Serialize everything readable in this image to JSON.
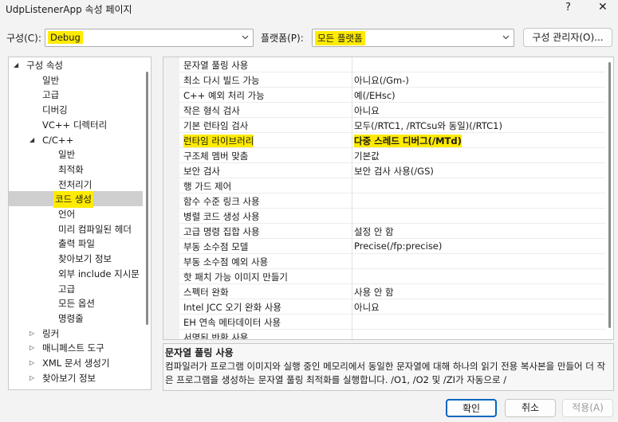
{
  "window": {
    "title": "UdpListenerApp 속성 페이지",
    "help": "?",
    "close": "✕"
  },
  "config": {
    "label": "구성(C):",
    "value": "Debug"
  },
  "platform": {
    "label": "플랫폼(P):",
    "value": "모든 플랫폼"
  },
  "config_manager_label": "구성 관리자(O)...",
  "tree": [
    {
      "label": "구성 속성",
      "level": 0,
      "arrow": "expanded",
      "selected": false
    },
    {
      "label": "일반",
      "level": 1,
      "arrow": "none",
      "selected": false
    },
    {
      "label": "고급",
      "level": 1,
      "arrow": "none",
      "selected": false
    },
    {
      "label": "디버깅",
      "level": 1,
      "arrow": "none",
      "selected": false
    },
    {
      "label": "VC++ 디렉터리",
      "level": 1,
      "arrow": "none",
      "selected": false
    },
    {
      "label": "C/C++",
      "level": 1,
      "arrow": "expanded",
      "selected": false
    },
    {
      "label": "일반",
      "level": 2,
      "arrow": "none",
      "selected": false
    },
    {
      "label": "최적화",
      "level": 2,
      "arrow": "none",
      "selected": false
    },
    {
      "label": "전처리기",
      "level": 2,
      "arrow": "none",
      "selected": false
    },
    {
      "label": "코드 생성",
      "level": 2,
      "arrow": "none",
      "selected": true
    },
    {
      "label": "언어",
      "level": 2,
      "arrow": "none",
      "selected": false
    },
    {
      "label": "미리 컴파일된 헤더",
      "level": 2,
      "arrow": "none",
      "selected": false
    },
    {
      "label": "출력 파일",
      "level": 2,
      "arrow": "none",
      "selected": false
    },
    {
      "label": "찾아보기 정보",
      "level": 2,
      "arrow": "none",
      "selected": false
    },
    {
      "label": "외부 include 지시문",
      "level": 2,
      "arrow": "none",
      "selected": false
    },
    {
      "label": "고급",
      "level": 2,
      "arrow": "none",
      "selected": false
    },
    {
      "label": "모든 옵션",
      "level": 2,
      "arrow": "none",
      "selected": false
    },
    {
      "label": "명령줄",
      "level": 2,
      "arrow": "none",
      "selected": false
    },
    {
      "label": "링커",
      "level": 1,
      "arrow": "collapsed",
      "selected": false
    },
    {
      "label": "매니페스트 도구",
      "level": 1,
      "arrow": "collapsed",
      "selected": false
    },
    {
      "label": "XML 문서 생성기",
      "level": 1,
      "arrow": "collapsed",
      "selected": false
    },
    {
      "label": "찾아보기 정보",
      "level": 1,
      "arrow": "collapsed",
      "selected": false
    }
  ],
  "properties": [
    {
      "name": "문자열 풀링 사용",
      "value": ""
    },
    {
      "name": "최소 다시 빌드 가능",
      "value": "아니요(/Gm-)"
    },
    {
      "name": "C++ 예외 처리 가능",
      "value": "예(/EHsc)"
    },
    {
      "name": "작은 형식 검사",
      "value": "아니요"
    },
    {
      "name": "기본 런타임 검사",
      "value": "모두(/RTC1, /RTCsu와 동일)(/RTC1)"
    },
    {
      "name": "런타임 라이브러리",
      "value": "다중 스레드 디버그(/MTd)",
      "highlight": true
    },
    {
      "name": "구조체 멤버 맞춤",
      "value": "기본값"
    },
    {
      "name": "보안 검사",
      "value": "보안 검사 사용(/GS)"
    },
    {
      "name": "행 가드 제어",
      "value": ""
    },
    {
      "name": "함수 수준 링크 사용",
      "value": ""
    },
    {
      "name": "병렬 코드 생성 사용",
      "value": ""
    },
    {
      "name": "고급 명령 집합 사용",
      "value": "설정 안 함"
    },
    {
      "name": "부동 소수점 모델",
      "value": "Precise(/fp:precise)"
    },
    {
      "name": "부동 소수점 예외 사용",
      "value": ""
    },
    {
      "name": "핫 패치 가능 이미지 만들기",
      "value": ""
    },
    {
      "name": "스펙터 완화",
      "value": "사용 안 함"
    },
    {
      "name": "Intel JCC 오기 완화 사용",
      "value": "아니요"
    },
    {
      "name": "EH 연속 메타데이터 사용",
      "value": ""
    },
    {
      "name": "서명된 반환 사용",
      "value": ""
    }
  ],
  "description": {
    "title": "문자열 풀링 사용",
    "text": "컴파일러가 프로그램 이미지와 실행 중인 메모리에서 동일한 문자열에 대해 하나의 읽기 전용 복사본을 만들어 더 작은 프로그램을 생성하는 문자열 풀링 최적화를 실행합니다. /O1, /O2 및 /ZI가 자동으로 /"
  },
  "buttons": {
    "ok": "확인",
    "cancel": "취소",
    "apply": "적용(A)"
  },
  "colors": {
    "highlight": "#ffeb00",
    "primary_border": "#0067c0",
    "selection": "#cfcfcf"
  }
}
